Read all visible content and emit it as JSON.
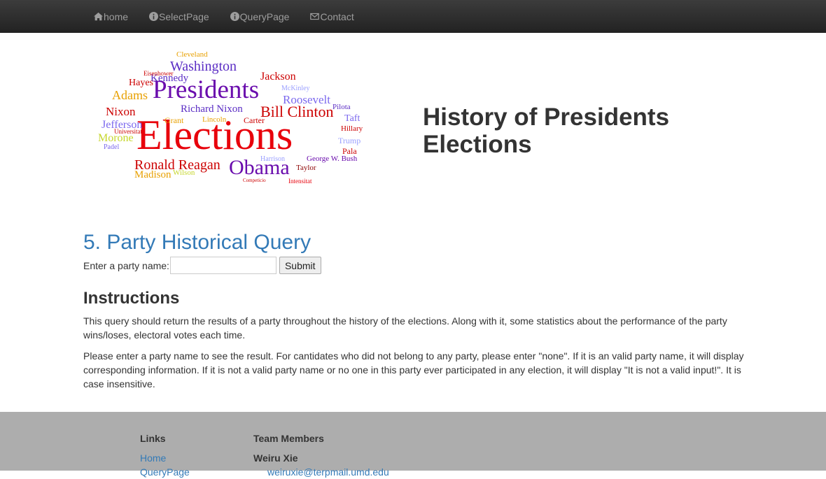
{
  "nav": {
    "home": "home",
    "select": "SelectPage",
    "query": "QueryPage",
    "contact": "Contact"
  },
  "hero": {
    "title": "History of Presidents Elections"
  },
  "cloud_words": [
    "Elections",
    "Presidents",
    "Obama",
    "Bill Clinton",
    "Ronald Reagan",
    "Washington",
    "Richard Nixon",
    "Jackson",
    "Kennedy",
    "Adams",
    "Nixon",
    "Jefferson",
    "Morone",
    "Madison",
    "Roosevelt",
    "Hayes",
    "Wilson",
    "Taylor",
    "Trump",
    "Pala",
    "Taft",
    "Hillary",
    "George W. Bush",
    "Pilota",
    "Carter",
    "Grant",
    "Lincoln",
    "Cleveland",
    "McKinley",
    "Intensitat",
    "Harrison",
    "Padel",
    "Universitat",
    "Competicio",
    "Eisenhower"
  ],
  "section": {
    "title": "5. Party Historical Query",
    "label": "Enter a party name:",
    "input_value": "",
    "submit": "Submit"
  },
  "instructions": {
    "title": "Instructions",
    "p1": "This query should return the results of a party throughout the history of the elections. Along with it, some statistics about the performance of the party wins/loses, electoral votes each time.",
    "p2": "Please enter a party name to see the result. For cantidates who did not belong to any party, please enter \"none\". If it is an valid party name, it will display corresponding information. If it is not a valid party name or no one in this party ever participated in any election, it will display \"It is not a valid input!\". It is case insensitive."
  },
  "footer": {
    "links_title": "Links",
    "links": [
      "Home",
      "QueryPage"
    ],
    "team_title": "Team Members",
    "member": "Weiru Xie",
    "email": "weiruxie@terpmail.umd.edu"
  },
  "colors": {
    "nav_bg": "#222222",
    "link": "#337ab7",
    "footer_bg": "#adadad"
  }
}
